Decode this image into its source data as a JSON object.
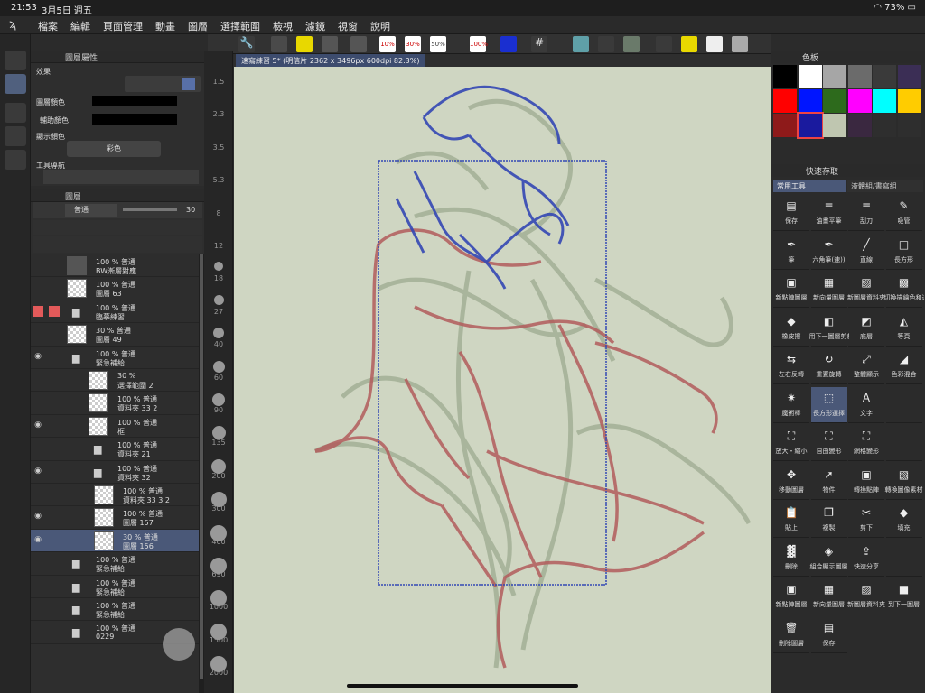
{
  "status": {
    "time": "21:53",
    "date": "3月5日 週五",
    "battery": "73%"
  },
  "menu": [
    "檔案",
    "編輯",
    "頁面管理",
    "動畫",
    "圖層",
    "選擇範圍",
    "檢視",
    "濾鏡",
    "視窗",
    "說明"
  ],
  "canvas_tab": "速寫練習 5* (明信片 2362 x 3496px 600dpi 82.3%)",
  "props": {
    "title": "圖層屬性",
    "effect": "效果",
    "layer_color": "圖層顏色",
    "sub_color": "輔助顏色",
    "display_color": "顯示顏色",
    "color_mode": "彩色",
    "tool_nav": "工具導航"
  },
  "layers": {
    "title": "圖層",
    "blend": "普通",
    "opacity": "30",
    "rows": [
      {
        "pct": "100 %",
        "mode": "普通",
        "name": "BW漸層對應"
      },
      {
        "pct": "100 %",
        "mode": "普通",
        "name": "圖層 63"
      },
      {
        "pct": "100 %",
        "mode": "普通",
        "name": "臨摹練習"
      },
      {
        "pct": "30 %",
        "mode": "普通",
        "name": "圖層 49"
      },
      {
        "pct": "100 %",
        "mode": "普通",
        "name": "緊急補給"
      },
      {
        "pct": "30 %",
        "mode": "",
        "name": "選擇範圍 2"
      },
      {
        "pct": "100 %",
        "mode": "普通",
        "name": "資料夾 33 2"
      },
      {
        "pct": "100 %",
        "mode": "普通",
        "name": "框"
      },
      {
        "pct": "100 %",
        "mode": "普通",
        "name": "資料夾 21"
      },
      {
        "pct": "100 %",
        "mode": "普通",
        "name": "資料夾 32"
      },
      {
        "pct": "100 %",
        "mode": "普通",
        "name": "資料夾 33 3 2"
      },
      {
        "pct": "100 %",
        "mode": "普通",
        "name": "圖層 157"
      },
      {
        "pct": "30 %",
        "mode": "普通",
        "name": "圖層 156"
      },
      {
        "pct": "100 %",
        "mode": "普通",
        "name": "緊急補給"
      },
      {
        "pct": "100 %",
        "mode": "普通",
        "name": "緊急補給"
      },
      {
        "pct": "100 %",
        "mode": "普通",
        "name": "緊急補給"
      },
      {
        "pct": "100 %",
        "mode": "普通",
        "name": "0229"
      }
    ]
  },
  "brush_sizes": [
    "1.5",
    "2.3",
    "3.5",
    "5.3",
    "8",
    "12",
    "18",
    "27",
    "40",
    "60",
    "90",
    "135",
    "200",
    "300",
    "460",
    "690",
    "1000",
    "1500",
    "2000"
  ],
  "toolbar_pcts": [
    "10%",
    "30%",
    "50%",
    "100%"
  ],
  "palette": {
    "title": "色板",
    "colors": [
      "#000000",
      "#ffffff",
      "#a6a6a6",
      "#6b6b6b",
      "#3a3a3a",
      "#3b2e55",
      "#ff0000",
      "#0015ff",
      "#2d6a1c",
      "#ff00ff",
      "#00ffff",
      "#ffcc00",
      "#8e1a1a",
      "#1a1a9e",
      "#bfc6b0",
      "#3a2840",
      "#2e2e2e",
      "#2e2e2e"
    ]
  },
  "quick": {
    "title": "快速存取",
    "tab1": "常用工具",
    "tab2": "液體組/書寫組",
    "items": [
      {
        "icon": "save-icon",
        "glyph": "▤",
        "label": "保存"
      },
      {
        "icon": "oil-pen-icon",
        "glyph": "≡",
        "label": "油畫平筆"
      },
      {
        "icon": "scrape-icon",
        "glyph": "≡",
        "label": "刮刀"
      },
      {
        "icon": "eyedropper-icon",
        "glyph": "✎",
        "label": "吸管"
      },
      {
        "icon": "pen-icon",
        "glyph": "✒",
        "label": "筆"
      },
      {
        "icon": "hexagon-pen-icon",
        "glyph": "✒",
        "label": "六角筆(速))"
      },
      {
        "icon": "line-icon",
        "glyph": "╱",
        "label": "直線"
      },
      {
        "icon": "rectangle-icon",
        "glyph": "□",
        "label": "長方形"
      },
      {
        "icon": "new-raster-icon",
        "glyph": "▣",
        "label": "新點陣圖層"
      },
      {
        "icon": "new-vector-icon",
        "glyph": "▦",
        "label": "新向量圖層"
      },
      {
        "icon": "new-folder-icon",
        "glyph": "▨",
        "label": "新圖層資料夾"
      },
      {
        "icon": "toggle-transparent-icon",
        "glyph": "▩",
        "label": "切換描繪色和透明"
      },
      {
        "icon": "eraser-icon",
        "glyph": "◆",
        "label": "橡皮擦"
      },
      {
        "icon": "merge-down-icon",
        "glyph": "◧",
        "label": "用下一圖層剪裁"
      },
      {
        "icon": "base-layer-icon",
        "glyph": "◩",
        "label": "底層"
      },
      {
        "icon": "isometric-icon",
        "glyph": "◭",
        "label": "等頁"
      },
      {
        "icon": "flip-horizontal-icon",
        "glyph": "⇆",
        "label": "左右反轉"
      },
      {
        "icon": "reset-rotation-icon",
        "glyph": "↻",
        "label": "重置旋轉"
      },
      {
        "icon": "fit-display-icon",
        "glyph": "⤢",
        "label": "整體顯示"
      },
      {
        "icon": "color-mix-icon",
        "glyph": "◢",
        "label": "色彩混合"
      },
      {
        "icon": "magic-wand-icon",
        "glyph": "✷",
        "label": "魔術棒"
      },
      {
        "icon": "rect-select-icon",
        "glyph": "⬚",
        "label": "長方形選擇"
      },
      {
        "icon": "text-icon",
        "glyph": "A",
        "label": "文字"
      },
      {
        "icon": "",
        "glyph": "",
        "label": ""
      },
      {
        "icon": "scale-icon",
        "glyph": "⛶",
        "label": "放大・縮小"
      },
      {
        "icon": "free-transform-icon",
        "glyph": "⛶",
        "label": "自由變形"
      },
      {
        "icon": "mesh-transform-icon",
        "glyph": "⛶",
        "label": "網格變形"
      },
      {
        "icon": "",
        "glyph": "",
        "label": ""
      },
      {
        "icon": "move-layer-icon",
        "glyph": "✥",
        "label": "移動圖層"
      },
      {
        "icon": "object-icon",
        "glyph": "➚",
        "label": "物件"
      },
      {
        "icon": "to-raster-icon",
        "glyph": "▣",
        "label": "轉換點陣"
      },
      {
        "icon": "to-image-icon",
        "glyph": "▧",
        "label": "轉換圖像素材"
      },
      {
        "icon": "paste-icon",
        "glyph": "📋",
        "label": "貼上"
      },
      {
        "icon": "copy-icon",
        "glyph": "❐",
        "label": "複製"
      },
      {
        "icon": "cut-icon",
        "glyph": "✂",
        "label": "剪下"
      },
      {
        "icon": "fill-icon",
        "glyph": "◆",
        "label": "填充"
      },
      {
        "icon": "delete-icon",
        "glyph": "▓",
        "label": "刪除"
      },
      {
        "icon": "merge-visible-icon",
        "glyph": "◈",
        "label": "組合顯示圖層"
      },
      {
        "icon": "share-icon",
        "glyph": "⇪",
        "label": "快速分享"
      },
      {
        "icon": "",
        "glyph": "",
        "label": ""
      },
      {
        "icon": "new-raster-icon-2",
        "glyph": "▣",
        "label": "新點陣圖層"
      },
      {
        "icon": "new-vector-icon-2",
        "glyph": "▦",
        "label": "新向量圖層"
      },
      {
        "icon": "new-folder-icon-2",
        "glyph": "▨",
        "label": "新圖層資料夾"
      },
      {
        "icon": "next-layer-icon",
        "glyph": "■",
        "label": "到下一圖層"
      },
      {
        "icon": "delete-layer-icon",
        "glyph": "🗑",
        "label": "刪除圖層"
      },
      {
        "icon": "save-icon-2",
        "glyph": "▤",
        "label": "保存"
      }
    ]
  }
}
